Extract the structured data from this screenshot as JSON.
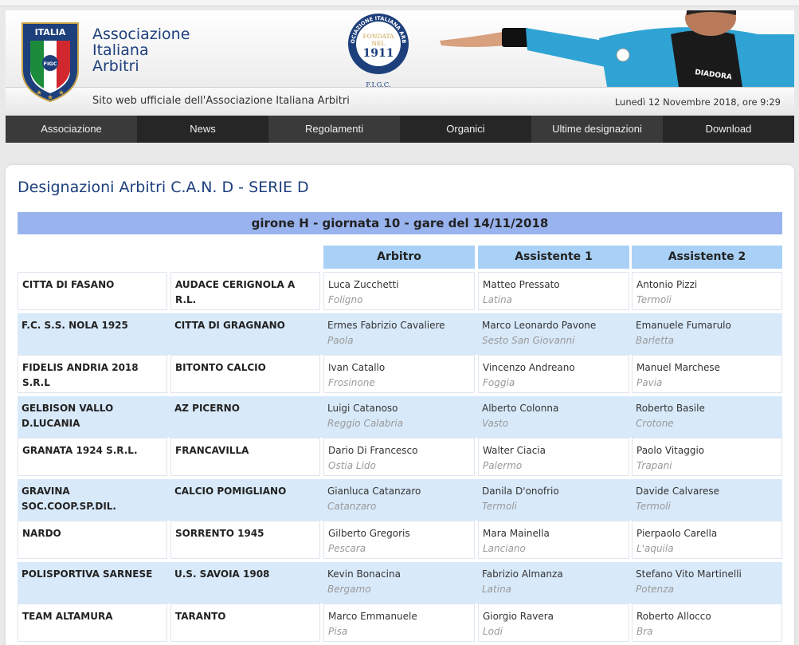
{
  "header": {
    "shield": {
      "top_text": "ITALIA",
      "badge_text": "FIGC"
    },
    "brand_lines": [
      "Associazione",
      "Italiana",
      "Arbitri"
    ],
    "seal": {
      "ring_text": "ASSOCIAZIONE ITALIANA ARBITRI",
      "line1": "FONDATA",
      "line2": "NEL",
      "year": "1911",
      "bottom_text": "F.I.G.C."
    },
    "sleeve_brand": "DIADORA",
    "tagline": "Sito web ufficiale dell'Associazione Italiana Arbitri",
    "date": "Lunedì 12 Novembre 2018, ore 9:29"
  },
  "nav": {
    "items": [
      "Associazione",
      "News",
      "Regolamenti",
      "Organici",
      "Ultime designazioni",
      "Download"
    ]
  },
  "page": {
    "title": "Designazioni Arbitri C.A.N. D - SERIE D",
    "girone": "girone H - giornata 10 - gare del 14/11/2018",
    "columns": [
      "Arbitro",
      "Assistente 1",
      "Assistente 2"
    ]
  },
  "matches": [
    {
      "home": "CITTA DI FASANO",
      "away": "AUDACE CERIGNOLA A R.L.",
      "arbitro": "Luca Zucchetti",
      "arbitro_city": "Foligno",
      "ass1": "Matteo Pressato",
      "ass1_city": "Latina",
      "ass2": "Antonio Pizzi",
      "ass2_city": "Termoli"
    },
    {
      "home": "F.C. S.S. NOLA 1925",
      "away": "CITTA DI GRAGNANO",
      "arbitro": "Ermes Fabrizio Cavaliere",
      "arbitro_city": "Paola",
      "ass1": "Marco Leonardo Pavone",
      "ass1_city": "Sesto San Giovanni",
      "ass2": "Emanuele Fumarulo",
      "ass2_city": "Barletta"
    },
    {
      "home": "FIDELIS ANDRIA 2018 S.R.L",
      "away": "BITONTO CALCIO",
      "arbitro": "Ivan Catallo",
      "arbitro_city": "Frosinone",
      "ass1": "Vincenzo Andreano",
      "ass1_city": "Foggia",
      "ass2": "Manuel Marchese",
      "ass2_city": "Pavia"
    },
    {
      "home": "GELBISON VALLO D.LUCANIA",
      "away": "AZ PICERNO",
      "arbitro": "Luigi Catanoso",
      "arbitro_city": "Reggio Calabria",
      "ass1": "Alberto Colonna",
      "ass1_city": "Vasto",
      "ass2": "Roberto Basile",
      "ass2_city": "Crotone"
    },
    {
      "home": "GRANATA 1924 S.R.L.",
      "away": "FRANCAVILLA",
      "arbitro": "Dario Di Francesco",
      "arbitro_city": "Ostia Lido",
      "ass1": "Walter Ciacia",
      "ass1_city": "Palermo",
      "ass2": "Paolo Vitaggio",
      "ass2_city": "Trapani"
    },
    {
      "home": "GRAVINA SOC.COOP.SP.DIL.",
      "away": "CALCIO POMIGLIANO",
      "arbitro": "Gianluca Catanzaro",
      "arbitro_city": "Catanzaro",
      "ass1": "Danila D'onofrio",
      "ass1_city": "Termoli",
      "ass2": "Davide Calvarese",
      "ass2_city": "Termoli"
    },
    {
      "home": "NARDO",
      "away": "SORRENTO 1945",
      "arbitro": "Gilberto Gregoris",
      "arbitro_city": "Pescara",
      "ass1": "Mara Mainella",
      "ass1_city": "Lanciano",
      "ass2": "Pierpaolo Carella",
      "ass2_city": "L'aquila"
    },
    {
      "home": "POLISPORTIVA SARNESE",
      "away": "U.S. SAVOIA 1908",
      "arbitro": "Kevin Bonacina",
      "arbitro_city": "Bergamo",
      "ass1": "Fabrizio Almanza",
      "ass1_city": "Latina",
      "ass2": "Stefano Vito Martinelli",
      "ass2_city": "Potenza"
    },
    {
      "home": "TEAM ALTAMURA",
      "away": "TARANTO",
      "arbitro": "Marco Emmanuele",
      "arbitro_city": "Pisa",
      "ass1": "Giorgio Ravera",
      "ass1_city": "Lodi",
      "ass2": "Roberto Allocco",
      "ass2_city": "Bra"
    }
  ],
  "colors": {
    "brand_blue": "#1d3f7c",
    "girone_bg": "#99b3ee",
    "col_head_bg": "#a9d1f7",
    "alt_row_bg": "#d8e9fa",
    "nav_bg": "#2f2f2f"
  }
}
